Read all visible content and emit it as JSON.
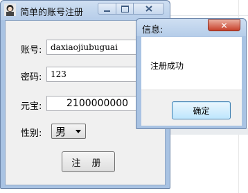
{
  "main_window": {
    "title": "简单的账号注册",
    "account_label": "账号:",
    "account_value": "daxiaojiubuguai",
    "password_label": "密码:",
    "password_value": "123",
    "gold_label": "元宝:",
    "gold_value": "2100000000",
    "gender_label": "性别:",
    "gender_value": "男",
    "register_button": "注 册"
  },
  "message_box": {
    "title": "信息:",
    "close_glyph": "✕",
    "message": "注册成功",
    "ok_button": "确定"
  },
  "icons": [
    "app-icon",
    "minimize-icon",
    "maximize-icon",
    "close-icon",
    "dropdown-arrow-icon"
  ]
}
